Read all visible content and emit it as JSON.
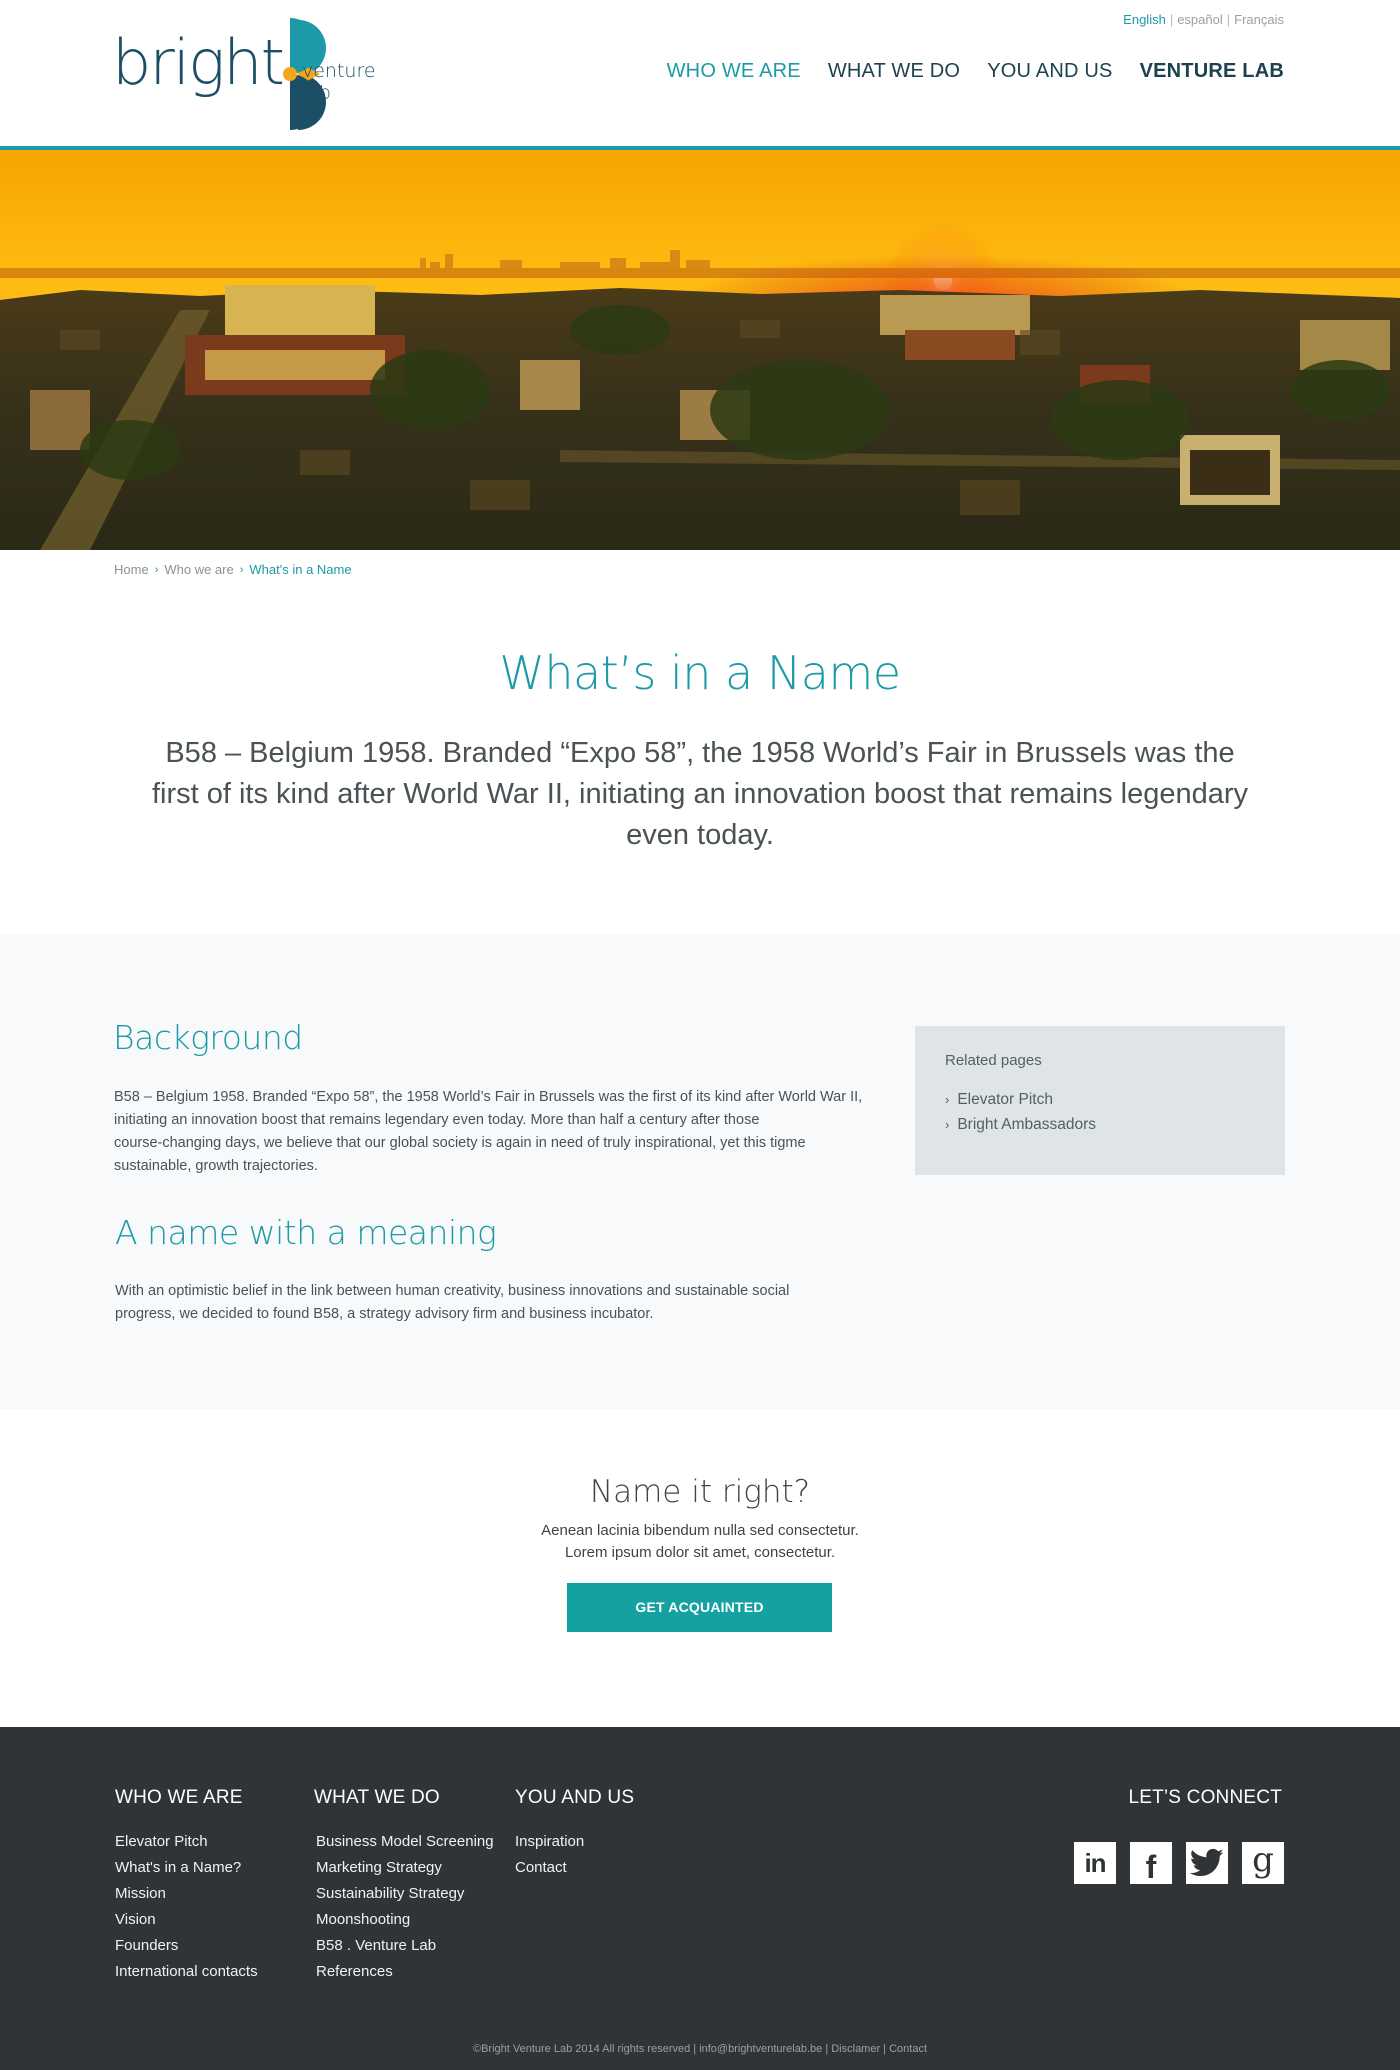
{
  "header": {
    "languages": [
      {
        "label": "English",
        "active": true
      },
      {
        "label": "español",
        "active": false
      },
      {
        "label": "Français",
        "active": false
      }
    ],
    "logo": {
      "word": "bright",
      "subtitle": "venture lab"
    },
    "nav": [
      {
        "label": "WHO WE ARE",
        "active": true
      },
      {
        "label": "WHAT WE DO",
        "active": false
      },
      {
        "label": "YOU AND US",
        "active": false
      },
      {
        "label": "VENTURE LAB",
        "active": false
      }
    ]
  },
  "breadcrumb": [
    "Home",
    "Who we are",
    "What's in a Name"
  ],
  "intro": {
    "title": "What’s in a Name",
    "lead": "B58 – Belgium 1958. Branded “Expo 58”, the 1958 World’s Fair in Brussels was the first of its kind after World War II, initiating an innovation boost that remains legendary even today."
  },
  "content": {
    "background": {
      "heading": "Background",
      "lines": [
        "B58 – Belgium 1958. Branded “Expo 58”, the 1958 World’s Fair in Brussels was the first of its kind after World War II,",
        "initiating an innovation boost that remains legendary even today. More than half a century after those",
        "course-changing days, we believe that our global society is again in need of truly inspirational, yet this tigme",
        "sustainable, growth trajectories."
      ]
    },
    "meaning": {
      "heading": "A name with a meaning",
      "lines": [
        "With an optimistic belief in the link between human creativity, business innovations and sustainable social",
        "progress, we decided to found B58, a strategy advisory firm and business incubator."
      ]
    },
    "related": {
      "title": "Related pages",
      "items": [
        "Elevator Pitch",
        "Bright Ambassadors"
      ]
    }
  },
  "cta": {
    "title": "Name it right?",
    "line1": "Aenean lacinia bibendum nulla sed consectetur.",
    "line2": "Lorem ipsum dolor sit amet, consectetur.",
    "button": "GET ACQUAINTED"
  },
  "footer": {
    "columns": [
      {
        "title": "WHO WE ARE",
        "items": [
          "Elevator Pitch",
          "What's in a Name?",
          "Mission",
          "Vision",
          "Founders",
          "International contacts"
        ]
      },
      {
        "title": "WHAT WE DO",
        "items": [
          "Business Model Screening",
          "Marketing Strategy",
          "Sustainability Strategy",
          "Moonshooting",
          "B58 . Venture Lab",
          "References"
        ]
      },
      {
        "title": "YOU AND US",
        "items": [
          "Inspiration",
          "Contact"
        ]
      }
    ],
    "connect_title": "LET’S CONNECT",
    "social": [
      "linkedin-icon",
      "facebook-icon",
      "twitter-icon",
      "google-plus-icon"
    ],
    "social_glyphs": [
      "in",
      "f",
      "",
      "g"
    ],
    "copyright": "©Bright Venture Lab 2014 All rights reserved | info@brightventurelab.be | Disclamer | Contact"
  },
  "colors": {
    "accent": "#1c9aa7",
    "button": "#15a1a1",
    "navy": "#1c4f66",
    "footer_bg": "#313436",
    "band_bg": "#f8f9fa",
    "related_bg": "#dfe5e7"
  }
}
